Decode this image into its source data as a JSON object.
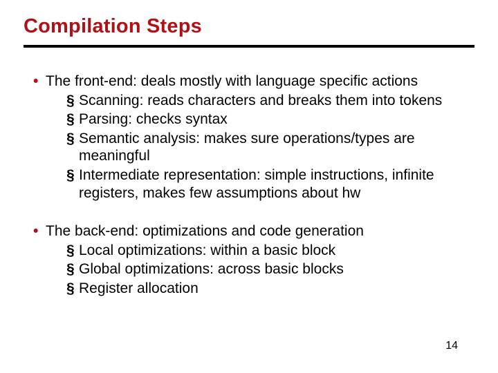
{
  "colors": {
    "accent": "#b11116"
  },
  "title": "Compilation Steps",
  "items": [
    {
      "text": "The front-end: deals mostly with language specific actions",
      "sub": [
        {
          "text": "Scanning: reads characters and breaks them into tokens"
        },
        {
          "text": "Parsing: checks syntax"
        },
        {
          "text": "Semantic analysis: makes sure operations/types are meaningful"
        },
        {
          "text": "Intermediate representation: simple instructions, infinite registers, makes few assumptions about hw"
        }
      ]
    },
    {
      "text": "The back-end: optimizations and code generation",
      "sub": [
        {
          "text": "Local optimizations: within a basic block"
        },
        {
          "text": "Global optimizations: across basic blocks"
        },
        {
          "text": "Register allocation"
        }
      ]
    }
  ],
  "page_number": "14"
}
